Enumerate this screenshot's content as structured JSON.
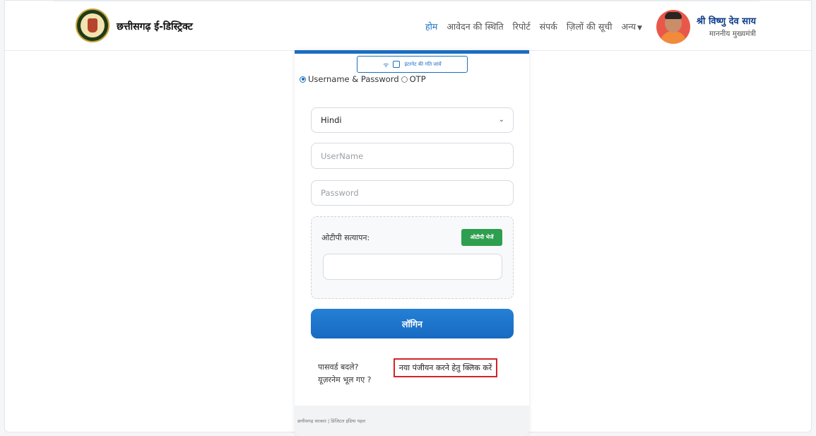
{
  "header": {
    "brand": "छत्तीसगढ़ ई-डिस्ट्रिक्ट",
    "nav": {
      "home": "होम",
      "application_status": "आवेदन की स्थिति",
      "reports": "रिपोर्ट",
      "contact": "संपर्क",
      "districts": "ज़िलों की सूची",
      "others": "अन्य"
    },
    "cm": {
      "name": "श्री विष्णु देव साय",
      "title": "माननीय मुख्यमंत्री"
    }
  },
  "login": {
    "qr_button": "इंटरनेट की गति जांचें",
    "radio_userpass": "Username & Password",
    "radio_otp": "OTP",
    "language_selected": "Hindi",
    "username_placeholder": "UserName",
    "password_placeholder": "Password",
    "otp_label": "ओटीपी सत्यापन:",
    "otp_button": "ओटीपी भेजें",
    "login_button": "लॉगिन",
    "change_password": "पासवर्ड बदले?",
    "forgot_username": "यूज़रनेम भूल गए ?",
    "register_link": "नया पंजीयन करने हेतु क्लिक करें",
    "footer": "छत्तीसगढ़ सरकार | डिजिटल इंडिया पहल"
  },
  "colors": {
    "accent": "#1b6ec2",
    "otp_button": "#2e9e4f",
    "highlight_border": "#d3232a"
  }
}
